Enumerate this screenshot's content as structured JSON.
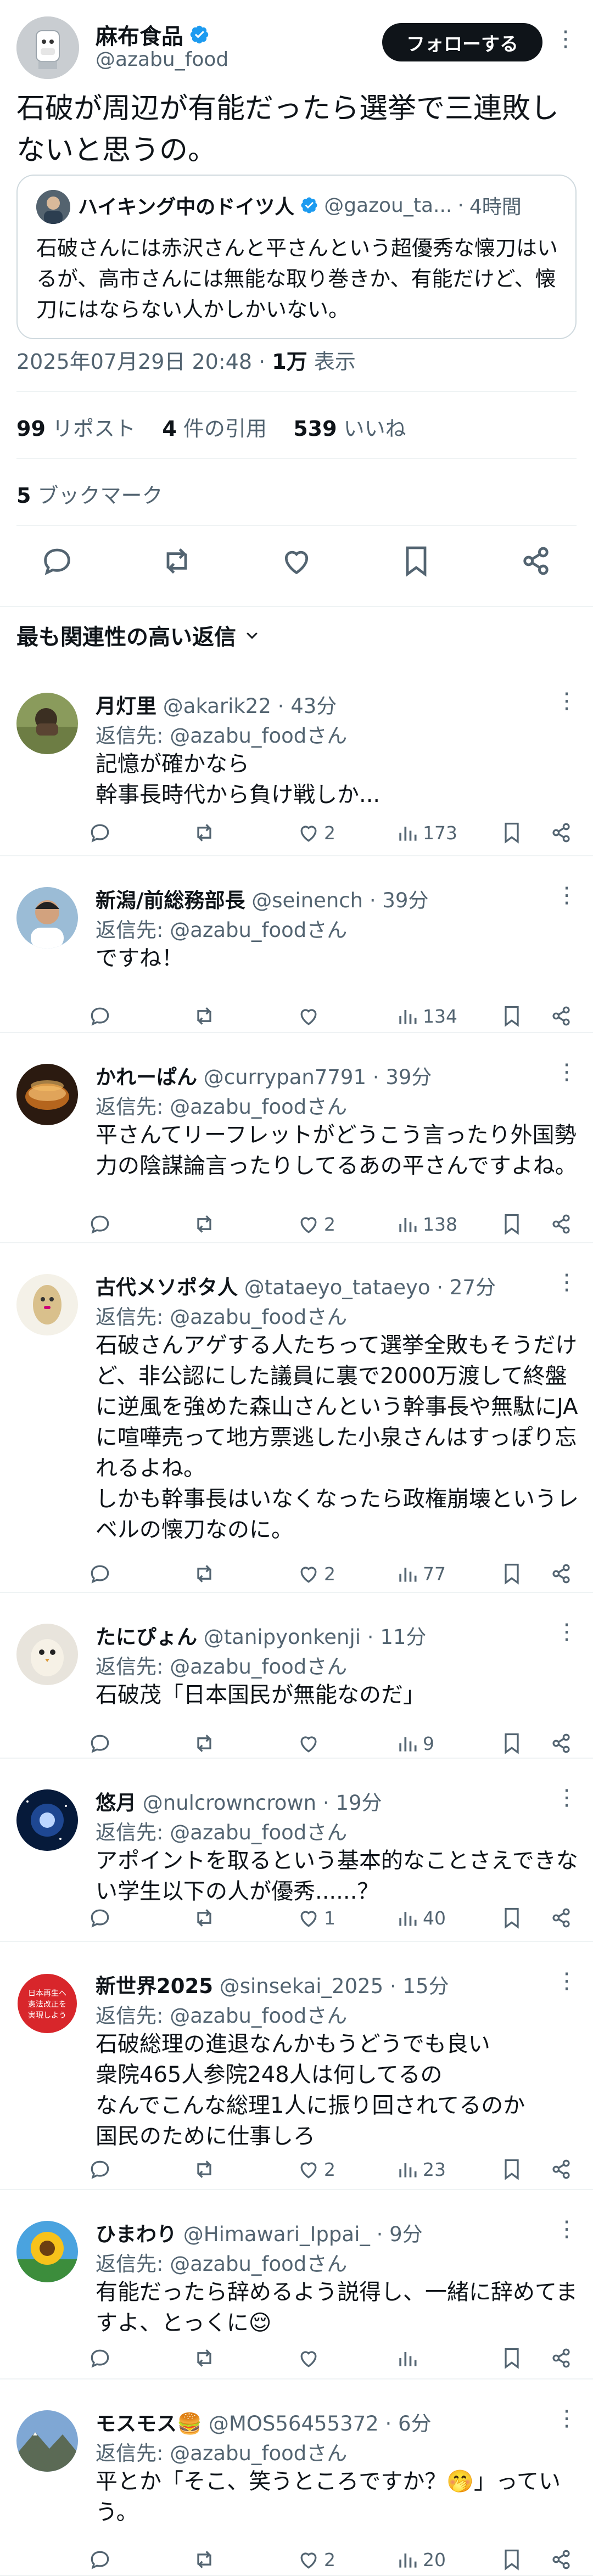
{
  "author": {
    "name": "麻布食品",
    "handle": "@azabu_food",
    "follow_label": "フォローする"
  },
  "post": {
    "text": "石破が周辺が有能だったら選挙で三連敗しないと思うの。",
    "date": "2025年07月29日 20:48",
    "views_count": "1万",
    "views_label": "表示"
  },
  "quote": {
    "name": "ハイキング中のドイツ人",
    "handle": "@gazou_ta...",
    "time": "4時間",
    "text": "石破さんには赤沢さんと平さんという超優秀な懐刀はいるが、高市さんには無能な取り巻きか、有能だけど、懐刀にはならない人かしかいない。"
  },
  "stats": {
    "reposts_count": "99",
    "reposts_label": "リポスト",
    "quotes_count": "4",
    "quotes_label": "件の引用",
    "likes_count": "539",
    "likes_label": "いいね",
    "bookmarks_count": "5",
    "bookmarks_label": "ブックマーク"
  },
  "sort": {
    "label": "最も関連性の高い返信"
  },
  "replies": [
    {
      "name": "月灯里",
      "handle": "@akarik22",
      "time": "43分",
      "reply_to": "返信先: @azabu_foodさん",
      "text": "記憶が確かなら\n幹事長時代から負け戦しか...",
      "replies": "",
      "reposts": "",
      "likes": "2",
      "views": "173"
    },
    {
      "name": "新潟/前総務部長",
      "handle": "@seinench",
      "time": "39分",
      "reply_to": "返信先: @azabu_foodさん",
      "text": "ですね！",
      "replies": "",
      "reposts": "",
      "likes": "",
      "views": "134"
    },
    {
      "name": "かれーぱん",
      "handle": "@currypan7791",
      "time": "39分",
      "reply_to": "返信先: @azabu_foodさん",
      "text": "平さんてリーフレットがどうこう言ったり外国勢力の陰謀論言ったりしてるあの平さんですよね。",
      "replies": "",
      "reposts": "",
      "likes": "2",
      "views": "138"
    },
    {
      "name": "古代メソポタ人",
      "handle": "@tataeyo_tataeyo",
      "time": "27分",
      "reply_to": "返信先: @azabu_foodさん",
      "text": "石破さんアゲする人たちって選挙全敗もそうだけど、非公認にした議員に裏で2000万渡して終盤に逆風を強めた森山さんという幹事長や無駄にJAに喧嘩売って地方票逃した小泉さんはすっぽり忘れるよね。\nしかも幹事長はいなくなったら政権崩壊というレベルの懐刀なのに。",
      "replies": "",
      "reposts": "",
      "likes": "2",
      "views": "77"
    },
    {
      "name": "たにぴょん",
      "handle": "@tanipyonkenji",
      "time": "11分",
      "reply_to": "返信先: @azabu_foodさん",
      "text": "石破茂「日本国民が無能なのだ」",
      "replies": "",
      "reposts": "",
      "likes": "",
      "views": "9"
    },
    {
      "name": "悠月",
      "handle": "@nulcrowncrown",
      "time": "19分",
      "reply_to": "返信先: @azabu_foodさん",
      "text": "アポイントを取るという基本的なことさえできない学生以下の人が優秀......？",
      "replies": "",
      "reposts": "",
      "likes": "1",
      "views": "40"
    },
    {
      "name": "新世界2025",
      "handle": "@sinsekai_2025",
      "time": "15分",
      "reply_to": "返信先: @azabu_foodさん",
      "text": "石破総理の進退なんかもうどうでも良い\n衆院465人参院248人は何してるの\nなんでこんな総理1人に振り回されてるのか\n国民のために仕事しろ",
      "replies": "",
      "reposts": "",
      "likes": "2",
      "views": "23"
    },
    {
      "name": "ひまわり",
      "handle": "@Himawari_Ippai_",
      "time": "9分",
      "reply_to": "返信先: @azabu_foodさん",
      "text": "有能だったら辞めるよう説得し、一緒に辞めてますよ、とっくに😌",
      "replies": "",
      "reposts": "",
      "likes": "",
      "views": ""
    },
    {
      "name": "モスモス🍔",
      "handle": "@MOS56455372",
      "time": "6分",
      "reply_to": "返信先: @azabu_foodさん",
      "text": "平とか「そこ、笑うところですか？🤭」っていう。",
      "replies": "",
      "reposts": "",
      "likes": "2",
      "views": "20"
    }
  ],
  "colors": {
    "accent": "#1d9bf0",
    "text": "#0f1419",
    "muted": "#536471",
    "border": "#eff3f4"
  },
  "avatar_icon": "sign-board-logo",
  "avatar_text": "日本再生へ 憲法改正を 実現しよう"
}
